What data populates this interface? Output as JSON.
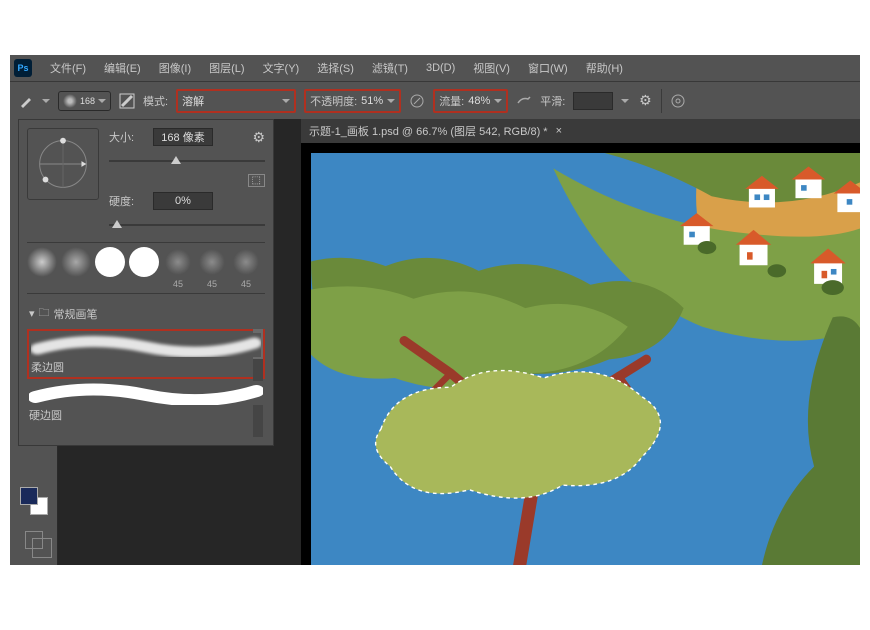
{
  "menu": {
    "file": "文件(F)",
    "edit": "编辑(E)",
    "image": "图像(I)",
    "layer": "图层(L)",
    "type": "文字(Y)",
    "select": "选择(S)",
    "filter": "滤镜(T)",
    "three_d": "3D(D)",
    "view": "视图(V)",
    "window": "窗口(W)",
    "help": "帮助(H)"
  },
  "options": {
    "brush_size_display": "168",
    "mode_label": "模式:",
    "mode_value": "溶解",
    "opacity_label": "不透明度:",
    "opacity_value": "51%",
    "flow_label": "流量:",
    "flow_value": "48%",
    "smoothing_label": "平滑:"
  },
  "brush_panel": {
    "size_label": "大小:",
    "size_value": "168 像素",
    "hardness_label": "硬度:",
    "hardness_value": "0%",
    "preset_values": [
      "45",
      "45",
      "45"
    ],
    "folder_name": "常规画笔",
    "brushes": [
      {
        "name": "柔边圆"
      },
      {
        "name": "硬边圆"
      }
    ]
  },
  "tab": {
    "title": "示题-1_画板 1.psd @ 66.7% (图层 542, RGB/8) *"
  }
}
